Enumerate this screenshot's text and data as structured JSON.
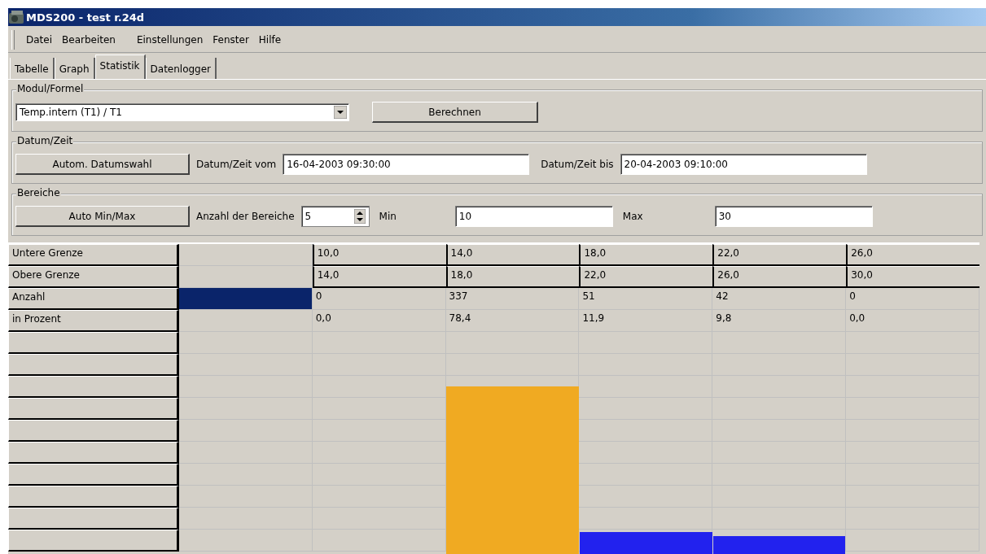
{
  "window": {
    "title": "MDS200 - test r.24d"
  },
  "menu": [
    "Datei",
    "Bearbeiten",
    "Einstellungen",
    "Fenster",
    "Hilfe"
  ],
  "tabs": [
    {
      "label": "Tabelle",
      "selected": false
    },
    {
      "label": "Graph",
      "selected": false
    },
    {
      "label": "Statistik",
      "selected": true
    },
    {
      "label": "Datenlogger",
      "selected": false
    }
  ],
  "modul": {
    "legend": "Modul/Formel",
    "select_value": "Temp.intern (T1) / T1",
    "button": "Berechnen"
  },
  "datum": {
    "legend": "Datum/Zeit",
    "button": "Autom. Datumswahl",
    "from_label": "Datum/Zeit vom",
    "from_value": "16-04-2003 09:30:00",
    "to_label": "Datum/Zeit bis",
    "to_value": "20-04-2003 09:10:00"
  },
  "bereiche": {
    "legend": "Bereiche",
    "button": "Auto Min/Max",
    "count_label": "Anzahl der Bereiche",
    "count_value": "5",
    "min_label": "Min",
    "min_value": "10",
    "max_label": "Max",
    "max_value": "30"
  },
  "table": {
    "rows": [
      {
        "label": "Untere Grenze",
        "kind": "bound",
        "selected": false,
        "values": [
          "10,0",
          "14,0",
          "18,0",
          "22,0",
          "26,0"
        ]
      },
      {
        "label": "Obere Grenze",
        "kind": "bound",
        "selected": false,
        "values": [
          "14,0",
          "18,0",
          "22,0",
          "26,0",
          "30,0"
        ]
      },
      {
        "label": "Anzahl",
        "kind": "value",
        "selected": true,
        "values": [
          "0",
          "337",
          "51",
          "42",
          "0"
        ]
      },
      {
        "label": "in Prozent",
        "kind": "value",
        "selected": false,
        "values": [
          "0,0",
          "78,4",
          "11,9",
          "9,8",
          "0,0"
        ]
      }
    ]
  }
}
